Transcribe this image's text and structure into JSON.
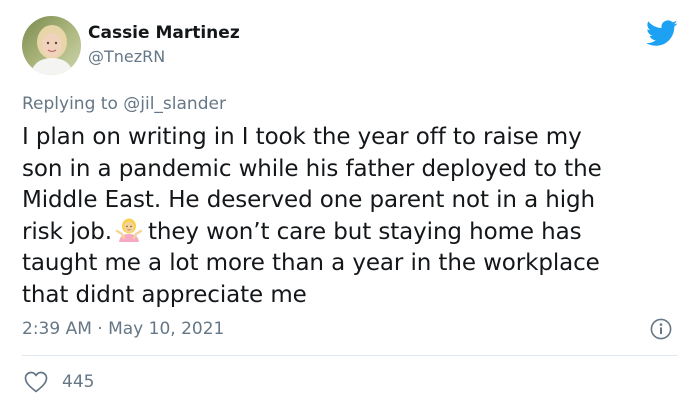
{
  "author": {
    "display_name": "Cassie Martinez",
    "handle": "@TnezRN"
  },
  "reply": {
    "prefix": "Replying to ",
    "mention": "@jil_slander"
  },
  "tweet": {
    "line1": "I plan on writing in I took the year off to raise my",
    "line2": "son in a pandemic while his father deployed to the",
    "line3": "Middle East. He deserved one parent not in a high",
    "line4_before_emoji": "risk job.",
    "emoji": "person-shrugging",
    "line4_after_emoji": "they won’t care but staying home has",
    "line5": "taught me a lot more than a year in the workplace",
    "line6": "that didnt appreciate me"
  },
  "timestamp": "2:39 AM · May 10, 2021",
  "likes": {
    "count": "445"
  },
  "colors": {
    "twitter_blue": "#1da1f2",
    "secondary_text": "#657786",
    "primary_text": "#14171a",
    "divider": "#e1e8ed"
  },
  "icons": {
    "brand": "twitter-bird-icon",
    "info": "info-icon",
    "like": "heart-icon"
  }
}
